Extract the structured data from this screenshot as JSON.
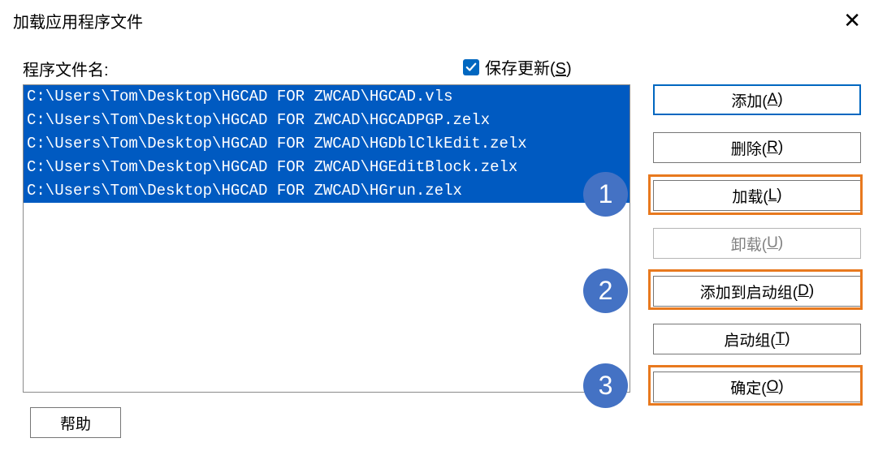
{
  "title": "加载应用程序文件",
  "file_list_label": "程序文件名:",
  "save_updates": {
    "label_pre": "保存更新(",
    "hotkey": "S",
    "label_post": ")",
    "checked": true
  },
  "files": [
    "C:\\Users\\Tom\\Desktop\\HGCAD FOR ZWCAD\\HGCAD.vls",
    "C:\\Users\\Tom\\Desktop\\HGCAD FOR ZWCAD\\HGCADPGP.zelx",
    "C:\\Users\\Tom\\Desktop\\HGCAD FOR ZWCAD\\HGDblClkEdit.zelx",
    "C:\\Users\\Tom\\Desktop\\HGCAD FOR ZWCAD\\HGEditBlock.zelx",
    "C:\\Users\\Tom\\Desktop\\HGCAD FOR ZWCAD\\HGrun.zelx"
  ],
  "buttons": {
    "add": {
      "pre": "添加(",
      "hot": "A",
      "post": ")"
    },
    "remove": {
      "pre": "删除(",
      "hot": "R",
      "post": ")"
    },
    "load": {
      "pre": "加载(",
      "hot": "L",
      "post": ")"
    },
    "unload": {
      "pre": "卸载(",
      "hot": "U",
      "post": ")"
    },
    "add_start": {
      "pre": "添加到启动组(",
      "hot": "D",
      "post": ")"
    },
    "start_grp": {
      "pre": "启动组(",
      "hot": "T",
      "post": ")"
    },
    "ok": {
      "pre": "确定(",
      "hot": "O",
      "post": ")"
    }
  },
  "help_label": "帮助",
  "badges": {
    "one": "1",
    "two": "2",
    "three": "3"
  }
}
